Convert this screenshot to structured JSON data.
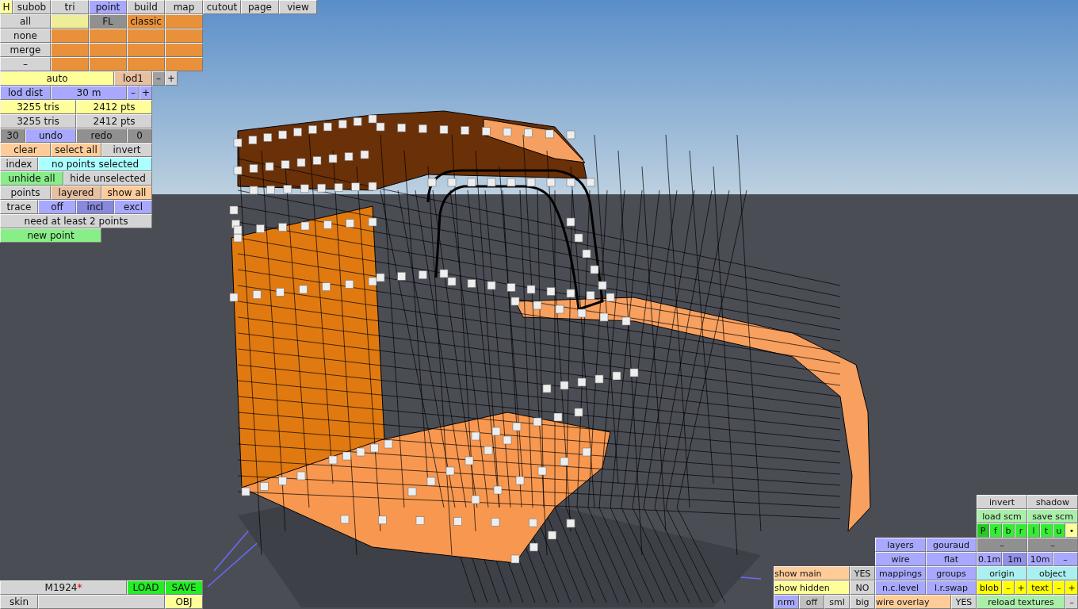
{
  "tabs": {
    "help": "H",
    "items": [
      {
        "label": "subob",
        "selected": false
      },
      {
        "label": "tri",
        "selected": false
      },
      {
        "label": "point",
        "selected": true
      },
      {
        "label": "build",
        "selected": false
      },
      {
        "label": "map",
        "selected": false
      },
      {
        "label": "cutout",
        "selected": false
      },
      {
        "label": "page",
        "selected": false
      },
      {
        "label": "view",
        "selected": false
      }
    ]
  },
  "panel_rows": [
    {
      "cells": [
        {
          "label": "all",
          "color": "#d4d4d4"
        },
        {
          "color": "#eeee99"
        },
        {
          "label": "FL",
          "color": "#909090"
        },
        {
          "label": "classic",
          "color": "#e8913a"
        },
        {
          "color": "#e8913a"
        }
      ]
    },
    {
      "cells": [
        {
          "label": "none",
          "color": "#d4d4d4"
        },
        {
          "color": "#e8913a"
        },
        {
          "color": "#e8913a"
        },
        {
          "color": "#e8913a"
        },
        {
          "color": "#e8913a"
        }
      ]
    },
    {
      "cells": [
        {
          "label": "merge",
          "color": "#d4d4d4"
        },
        {
          "color": "#e8913a"
        },
        {
          "color": "#e8913a"
        },
        {
          "color": "#e8913a"
        },
        {
          "color": "#e8913a"
        }
      ]
    },
    {
      "cells": [
        {
          "label": "–",
          "color": "#d4d4d4"
        },
        {
          "color": "#e8913a"
        },
        {
          "color": "#e8913a"
        },
        {
          "color": "#e8913a"
        },
        {
          "color": "#e8913a"
        }
      ]
    },
    {
      "cells": [
        {
          "label": "auto",
          "color": "#ffff99"
        },
        {
          "label": "lod1",
          "color": "#e8c0a0"
        },
        {
          "label": "–",
          "color": "#a0a0a0"
        },
        {
          "label": "+",
          "color": "#d4d4d4"
        }
      ]
    },
    {
      "cells": [
        {
          "label": "lod dist",
          "color": "#a8a8ff"
        },
        {
          "label": "30 m",
          "color": "#a8a8ff"
        },
        {
          "label": "–",
          "color": "#a8a8ff"
        },
        {
          "label": "+",
          "color": "#a8a8ff"
        }
      ]
    },
    {
      "cells": [
        {
          "label": "3255 tris",
          "color": "#ffff99"
        },
        {
          "label": "2412 pts",
          "color": "#ffff99"
        }
      ]
    },
    {
      "cells": [
        {
          "label": "3255 tris",
          "color": "#d4d4d4"
        },
        {
          "label": "2412 pts",
          "color": "#d4d4d4"
        }
      ]
    },
    {
      "cells": [
        {
          "label": "30",
          "color": "#909090"
        },
        {
          "label": "undo",
          "color": "#a8a8ff"
        },
        {
          "label": "redo",
          "color": "#909090"
        },
        {
          "label": "0",
          "color": "#909090"
        }
      ]
    },
    {
      "cells": [
        {
          "label": "clear",
          "color": "#ffcc99"
        },
        {
          "label": "select all",
          "color": "#ffcc99"
        },
        {
          "label": "invert",
          "color": "#d4d4d4"
        }
      ]
    },
    {
      "cells": [
        {
          "label": "index",
          "color": "#d4d4d4"
        },
        {
          "label": "no points selected",
          "color": "#aaffff"
        }
      ]
    },
    {
      "cells": [
        {
          "label": "unhide all",
          "color": "#88ee88"
        },
        {
          "label": "hide unselected",
          "color": "#d4d4d4"
        }
      ]
    },
    {
      "cells": [
        {
          "label": "points",
          "color": "#d4d4d4"
        },
        {
          "label": "layered",
          "color": "#e8c0a0"
        },
        {
          "label": "show all",
          "color": "#ffcc99"
        }
      ]
    },
    {
      "cells": [
        {
          "label": "trace",
          "color": "#d4d4d4"
        },
        {
          "label": "off",
          "color": "#a8a8ff"
        },
        {
          "label": "incl",
          "color": "#8888dd"
        },
        {
          "label": "excl",
          "color": "#a8a8ff"
        }
      ]
    },
    {
      "cells": [
        {
          "label": "need at least 2 points",
          "color": "#d4d4d4"
        }
      ]
    },
    {
      "cells": [
        {
          "label": "new point",
          "color": "#88ee88"
        }
      ]
    }
  ],
  "file_bar": {
    "name": "M1924",
    "modified_mark": "*",
    "load": "LOAD",
    "save": "SAVE",
    "skin": "skin",
    "format": "OBJ"
  },
  "view_panel": {
    "cells": [
      {
        "label": "invert",
        "color": "#d4d4d4"
      },
      {
        "label": "shadow",
        "color": "#d4d4d4"
      },
      {
        "label": "load scm",
        "color": "#aaeeaa"
      },
      {
        "label": "save scm",
        "color": "#aaeeaa"
      },
      {
        "label": "P",
        "color": "#22cc22"
      },
      {
        "label": "f",
        "color": "#33ee33"
      },
      {
        "label": "b",
        "color": "#33ee33"
      },
      {
        "label": "r",
        "color": "#33ee33"
      },
      {
        "label": "l",
        "color": "#33ee33"
      },
      {
        "label": "t",
        "color": "#33ee33"
      },
      {
        "label": "u",
        "color": "#33ee33"
      },
      {
        "label": "•",
        "color": "#ffff99"
      },
      {
        "label": "layers",
        "color": "#a8a8ff"
      },
      {
        "label": "gouraud",
        "color": "#a8a8ff"
      },
      {
        "label": "–",
        "color": "#909090"
      },
      {
        "label": "–",
        "color": "#909090"
      },
      {
        "label": "wire",
        "color": "#a8a8ff"
      },
      {
        "label": "flat",
        "color": "#a8a8ff"
      },
      {
        "label": "0.1m",
        "color": "#a8a8ff"
      },
      {
        "label": "1m",
        "color": "#9090e8"
      },
      {
        "label": "10m",
        "color": "#a8a8ff"
      },
      {
        "label": "–",
        "color": "#a8a8ff"
      },
      {
        "label": "show main",
        "color": "#ffcc99"
      },
      {
        "label": "YES",
        "color": "#c8c8c8"
      },
      {
        "label": "mappings",
        "color": "#a8a8ff"
      },
      {
        "label": "groups",
        "color": "#a8a8ff"
      },
      {
        "label": "origin",
        "color": "#aaf0f0"
      },
      {
        "label": "object",
        "color": "#aaf0f0"
      },
      {
        "label": "show hidden",
        "color": "#ffff99"
      },
      {
        "label": "NO",
        "color": "#d4d4d4"
      },
      {
        "label": "n.c.level",
        "color": "#a8a8ff"
      },
      {
        "label": "l.r.swap",
        "color": "#a8a8ff"
      },
      {
        "label": "blob",
        "color": "#ffff00"
      },
      {
        "label": "–",
        "color": "#ffff00"
      },
      {
        "label": "+",
        "color": "#ffff00"
      },
      {
        "label": "text",
        "color": "#ffff00"
      },
      {
        "label": "–",
        "color": "#ffff00"
      },
      {
        "label": "+",
        "color": "#ffff00"
      },
      {
        "label": "nrm",
        "color": "#a8a8ff"
      },
      {
        "label": "off",
        "color": "#c0c0c0"
      },
      {
        "label": "sml",
        "color": "#d4d4d4"
      },
      {
        "label": "big",
        "color": "#d4d4d4"
      },
      {
        "label": "wire overlay",
        "color": "#ffcc99"
      },
      {
        "label": "YES",
        "color": "#d4d4d4"
      },
      {
        "label": "reload textures",
        "color": "#aaeeaa"
      },
      {
        "label": "–",
        "color": "#d4d4d4"
      }
    ]
  }
}
